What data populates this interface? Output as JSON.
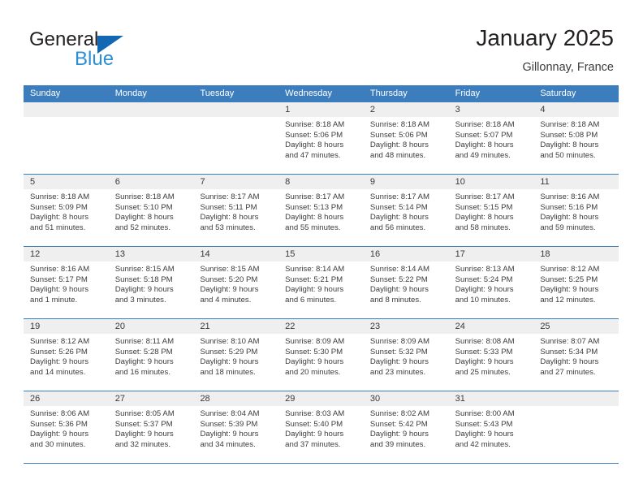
{
  "brand": {
    "name_top": "General",
    "name_bottom": "Blue",
    "triangle_color": "#1268b3",
    "blue_text_color": "#2a8fd4"
  },
  "header": {
    "title": "January 2025",
    "subtitle": "Gillonnay, France"
  },
  "theme": {
    "header_blue": "#3b7dbd",
    "day_header_gray": "#efefef",
    "text_color": "#3c3c3c"
  },
  "weekdays": [
    "Sunday",
    "Monday",
    "Tuesday",
    "Wednesday",
    "Thursday",
    "Friday",
    "Saturday"
  ],
  "weeks": [
    [
      {
        "day": "",
        "sunrise": "",
        "sunset": "",
        "daylight_1": "",
        "daylight_2": ""
      },
      {
        "day": "",
        "sunrise": "",
        "sunset": "",
        "daylight_1": "",
        "daylight_2": ""
      },
      {
        "day": "",
        "sunrise": "",
        "sunset": "",
        "daylight_1": "",
        "daylight_2": ""
      },
      {
        "day": "1",
        "sunrise": "Sunrise: 8:18 AM",
        "sunset": "Sunset: 5:06 PM",
        "daylight_1": "Daylight: 8 hours",
        "daylight_2": "and 47 minutes."
      },
      {
        "day": "2",
        "sunrise": "Sunrise: 8:18 AM",
        "sunset": "Sunset: 5:06 PM",
        "daylight_1": "Daylight: 8 hours",
        "daylight_2": "and 48 minutes."
      },
      {
        "day": "3",
        "sunrise": "Sunrise: 8:18 AM",
        "sunset": "Sunset: 5:07 PM",
        "daylight_1": "Daylight: 8 hours",
        "daylight_2": "and 49 minutes."
      },
      {
        "day": "4",
        "sunrise": "Sunrise: 8:18 AM",
        "sunset": "Sunset: 5:08 PM",
        "daylight_1": "Daylight: 8 hours",
        "daylight_2": "and 50 minutes."
      }
    ],
    [
      {
        "day": "5",
        "sunrise": "Sunrise: 8:18 AM",
        "sunset": "Sunset: 5:09 PM",
        "daylight_1": "Daylight: 8 hours",
        "daylight_2": "and 51 minutes."
      },
      {
        "day": "6",
        "sunrise": "Sunrise: 8:18 AM",
        "sunset": "Sunset: 5:10 PM",
        "daylight_1": "Daylight: 8 hours",
        "daylight_2": "and 52 minutes."
      },
      {
        "day": "7",
        "sunrise": "Sunrise: 8:17 AM",
        "sunset": "Sunset: 5:11 PM",
        "daylight_1": "Daylight: 8 hours",
        "daylight_2": "and 53 minutes."
      },
      {
        "day": "8",
        "sunrise": "Sunrise: 8:17 AM",
        "sunset": "Sunset: 5:13 PM",
        "daylight_1": "Daylight: 8 hours",
        "daylight_2": "and 55 minutes."
      },
      {
        "day": "9",
        "sunrise": "Sunrise: 8:17 AM",
        "sunset": "Sunset: 5:14 PM",
        "daylight_1": "Daylight: 8 hours",
        "daylight_2": "and 56 minutes."
      },
      {
        "day": "10",
        "sunrise": "Sunrise: 8:17 AM",
        "sunset": "Sunset: 5:15 PM",
        "daylight_1": "Daylight: 8 hours",
        "daylight_2": "and 58 minutes."
      },
      {
        "day": "11",
        "sunrise": "Sunrise: 8:16 AM",
        "sunset": "Sunset: 5:16 PM",
        "daylight_1": "Daylight: 8 hours",
        "daylight_2": "and 59 minutes."
      }
    ],
    [
      {
        "day": "12",
        "sunrise": "Sunrise: 8:16 AM",
        "sunset": "Sunset: 5:17 PM",
        "daylight_1": "Daylight: 9 hours",
        "daylight_2": "and 1 minute."
      },
      {
        "day": "13",
        "sunrise": "Sunrise: 8:15 AM",
        "sunset": "Sunset: 5:18 PM",
        "daylight_1": "Daylight: 9 hours",
        "daylight_2": "and 3 minutes."
      },
      {
        "day": "14",
        "sunrise": "Sunrise: 8:15 AM",
        "sunset": "Sunset: 5:20 PM",
        "daylight_1": "Daylight: 9 hours",
        "daylight_2": "and 4 minutes."
      },
      {
        "day": "15",
        "sunrise": "Sunrise: 8:14 AM",
        "sunset": "Sunset: 5:21 PM",
        "daylight_1": "Daylight: 9 hours",
        "daylight_2": "and 6 minutes."
      },
      {
        "day": "16",
        "sunrise": "Sunrise: 8:14 AM",
        "sunset": "Sunset: 5:22 PM",
        "daylight_1": "Daylight: 9 hours",
        "daylight_2": "and 8 minutes."
      },
      {
        "day": "17",
        "sunrise": "Sunrise: 8:13 AM",
        "sunset": "Sunset: 5:24 PM",
        "daylight_1": "Daylight: 9 hours",
        "daylight_2": "and 10 minutes."
      },
      {
        "day": "18",
        "sunrise": "Sunrise: 8:12 AM",
        "sunset": "Sunset: 5:25 PM",
        "daylight_1": "Daylight: 9 hours",
        "daylight_2": "and 12 minutes."
      }
    ],
    [
      {
        "day": "19",
        "sunrise": "Sunrise: 8:12 AM",
        "sunset": "Sunset: 5:26 PM",
        "daylight_1": "Daylight: 9 hours",
        "daylight_2": "and 14 minutes."
      },
      {
        "day": "20",
        "sunrise": "Sunrise: 8:11 AM",
        "sunset": "Sunset: 5:28 PM",
        "daylight_1": "Daylight: 9 hours",
        "daylight_2": "and 16 minutes."
      },
      {
        "day": "21",
        "sunrise": "Sunrise: 8:10 AM",
        "sunset": "Sunset: 5:29 PM",
        "daylight_1": "Daylight: 9 hours",
        "daylight_2": "and 18 minutes."
      },
      {
        "day": "22",
        "sunrise": "Sunrise: 8:09 AM",
        "sunset": "Sunset: 5:30 PM",
        "daylight_1": "Daylight: 9 hours",
        "daylight_2": "and 20 minutes."
      },
      {
        "day": "23",
        "sunrise": "Sunrise: 8:09 AM",
        "sunset": "Sunset: 5:32 PM",
        "daylight_1": "Daylight: 9 hours",
        "daylight_2": "and 23 minutes."
      },
      {
        "day": "24",
        "sunrise": "Sunrise: 8:08 AM",
        "sunset": "Sunset: 5:33 PM",
        "daylight_1": "Daylight: 9 hours",
        "daylight_2": "and 25 minutes."
      },
      {
        "day": "25",
        "sunrise": "Sunrise: 8:07 AM",
        "sunset": "Sunset: 5:34 PM",
        "daylight_1": "Daylight: 9 hours",
        "daylight_2": "and 27 minutes."
      }
    ],
    [
      {
        "day": "26",
        "sunrise": "Sunrise: 8:06 AM",
        "sunset": "Sunset: 5:36 PM",
        "daylight_1": "Daylight: 9 hours",
        "daylight_2": "and 30 minutes."
      },
      {
        "day": "27",
        "sunrise": "Sunrise: 8:05 AM",
        "sunset": "Sunset: 5:37 PM",
        "daylight_1": "Daylight: 9 hours",
        "daylight_2": "and 32 minutes."
      },
      {
        "day": "28",
        "sunrise": "Sunrise: 8:04 AM",
        "sunset": "Sunset: 5:39 PM",
        "daylight_1": "Daylight: 9 hours",
        "daylight_2": "and 34 minutes."
      },
      {
        "day": "29",
        "sunrise": "Sunrise: 8:03 AM",
        "sunset": "Sunset: 5:40 PM",
        "daylight_1": "Daylight: 9 hours",
        "daylight_2": "and 37 minutes."
      },
      {
        "day": "30",
        "sunrise": "Sunrise: 8:02 AM",
        "sunset": "Sunset: 5:42 PM",
        "daylight_1": "Daylight: 9 hours",
        "daylight_2": "and 39 minutes."
      },
      {
        "day": "31",
        "sunrise": "Sunrise: 8:00 AM",
        "sunset": "Sunset: 5:43 PM",
        "daylight_1": "Daylight: 9 hours",
        "daylight_2": "and 42 minutes."
      },
      {
        "day": "",
        "sunrise": "",
        "sunset": "",
        "daylight_1": "",
        "daylight_2": ""
      }
    ]
  ]
}
